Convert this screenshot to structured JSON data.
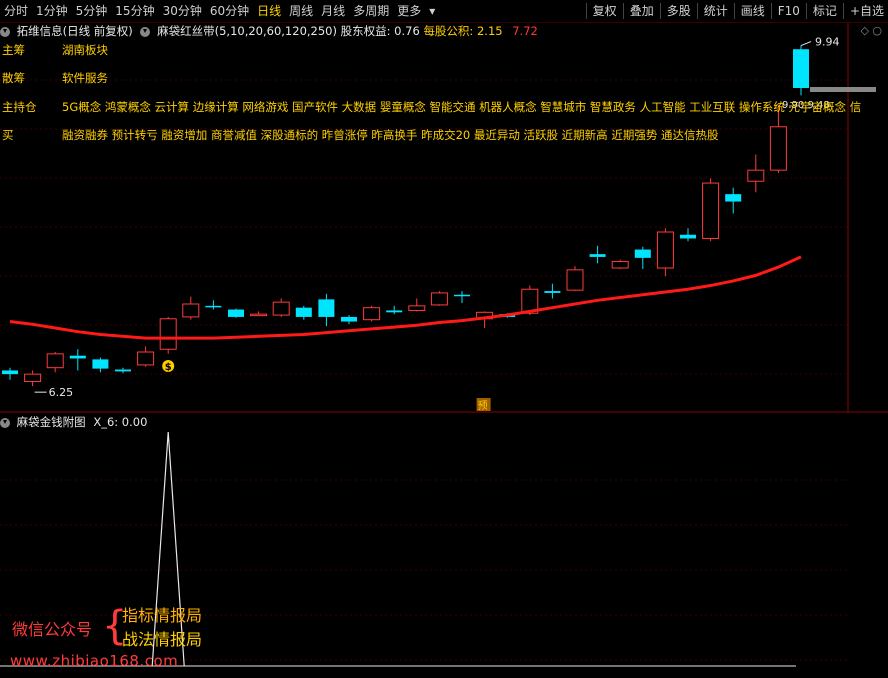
{
  "toolbar": {
    "periods": [
      "分时",
      "1分钟",
      "5分钟",
      "15分钟",
      "30分钟",
      "60分钟",
      "日线",
      "周线",
      "月线",
      "多周期",
      "更多"
    ],
    "active_period": "日线",
    "right_buttons": [
      "复权",
      "叠加",
      "多股",
      "统计",
      "画线",
      "F10",
      "标记",
      "+自选"
    ]
  },
  "info": {
    "stock": "拓维信息(日线 前复权)",
    "indicator": "麻袋红丝带(5,10,20,60,120,250)",
    "equity_label": "股东权益:",
    "equity_value": "0.76",
    "navps_label": "每股公积:",
    "navps_value": "2.15",
    "price": "7.72"
  },
  "labels": {
    "main": {
      "tag": "主筹",
      "value": "湖南板块"
    },
    "retail": {
      "tag": "散筹",
      "value": "软件服务"
    },
    "holdings": {
      "tag": "主持仓",
      "value": "5G概念 鸿蒙概念 云计算 边缘计算 网络游戏 国产软件 大数据 婴童概念 智能交通 机器人概念 智慧城市 智慧政务 人工智能 工业互联 操作系统 元宇宙概念 信"
    },
    "buy": {
      "tag": "买",
      "value": "融资融券 预计转亏 融资增加 商誉减值 深股通标的 昨曾涨停 昨高换手 昨成交20 最近异动 活跃股 近期新高 近期强势 通达信热股"
    }
  },
  "annotations": {
    "high": "9.94",
    "low": "6.25",
    "overlap": "9.90 9.48",
    "pre_marker": "预",
    "money_marker": "$"
  },
  "sub_panel": {
    "title": "麻袋金钱附图",
    "value_label": "X_6: 0.00"
  },
  "watermark": {
    "left": "微信公众号",
    "brace": "{",
    "line1": "指标情报局",
    "line2": "战法情报局",
    "url": "www.zhibiao168.com"
  },
  "colors": {
    "up": "#ff3b3b",
    "down": "#00e5ff",
    "ma": "#ff1a1a",
    "bg": "#000000",
    "highlight": "#ffd000"
  },
  "chart_data": {
    "type": "candlestick",
    "candles": [
      {
        "o": 6.42,
        "c": 6.38,
        "h": 6.45,
        "l": 6.32
      },
      {
        "o": 6.3,
        "c": 6.38,
        "h": 6.42,
        "l": 6.25
      },
      {
        "o": 6.45,
        "c": 6.6,
        "h": 6.62,
        "l": 6.4
      },
      {
        "o": 6.58,
        "c": 6.55,
        "h": 6.65,
        "l": 6.42
      },
      {
        "o": 6.54,
        "c": 6.44,
        "h": 6.56,
        "l": 6.4
      },
      {
        "o": 6.43,
        "c": 6.41,
        "h": 6.45,
        "l": 6.39
      },
      {
        "o": 6.48,
        "c": 6.62,
        "h": 6.68,
        "l": 6.46
      },
      {
        "o": 6.65,
        "c": 6.98,
        "h": 7.0,
        "l": 6.6
      },
      {
        "o": 7.0,
        "c": 7.14,
        "h": 7.22,
        "l": 6.97
      },
      {
        "o": 7.12,
        "c": 7.11,
        "h": 7.18,
        "l": 7.08
      },
      {
        "o": 7.08,
        "c": 7.0,
        "h": 7.09,
        "l": 6.99
      },
      {
        "o": 7.02,
        "c": 7.03,
        "h": 7.06,
        "l": 7.01
      },
      {
        "o": 7.02,
        "c": 7.16,
        "h": 7.2,
        "l": 7.0
      },
      {
        "o": 7.1,
        "c": 7.0,
        "h": 7.12,
        "l": 6.97
      },
      {
        "o": 7.19,
        "c": 7.0,
        "h": 7.25,
        "l": 6.9
      },
      {
        "o": 7.0,
        "c": 6.95,
        "h": 7.02,
        "l": 6.92
      },
      {
        "o": 6.97,
        "c": 7.1,
        "h": 7.12,
        "l": 6.95
      },
      {
        "o": 7.07,
        "c": 7.05,
        "h": 7.12,
        "l": 7.03
      },
      {
        "o": 7.07,
        "c": 7.12,
        "h": 7.2,
        "l": 7.06
      },
      {
        "o": 7.13,
        "c": 7.26,
        "h": 7.28,
        "l": 7.12
      },
      {
        "o": 7.24,
        "c": 7.23,
        "h": 7.28,
        "l": 7.15
      },
      {
        "o": 6.98,
        "c": 7.05,
        "h": 7.06,
        "l": 6.88
      },
      {
        "o": 7.03,
        "c": 7.0,
        "h": 7.04,
        "l": 6.99
      },
      {
        "o": 7.04,
        "c": 7.3,
        "h": 7.34,
        "l": 7.02
      },
      {
        "o": 7.28,
        "c": 7.26,
        "h": 7.36,
        "l": 7.2
      },
      {
        "o": 7.29,
        "c": 7.51,
        "h": 7.55,
        "l": 7.28
      },
      {
        "o": 7.68,
        "c": 7.65,
        "h": 7.77,
        "l": 7.58
      },
      {
        "o": 7.53,
        "c": 7.6,
        "h": 7.62,
        "l": 7.52
      },
      {
        "o": 7.73,
        "c": 7.64,
        "h": 7.76,
        "l": 7.52
      },
      {
        "o": 7.53,
        "c": 7.92,
        "h": 7.96,
        "l": 7.44
      },
      {
        "o": 7.89,
        "c": 7.85,
        "h": 7.96,
        "l": 7.82
      },
      {
        "o": 7.85,
        "c": 8.45,
        "h": 8.5,
        "l": 7.82
      },
      {
        "o": 8.33,
        "c": 8.25,
        "h": 8.4,
        "l": 8.12
      },
      {
        "o": 8.47,
        "c": 8.59,
        "h": 8.76,
        "l": 8.35
      },
      {
        "o": 8.59,
        "c": 9.06,
        "h": 9.3,
        "l": 8.56
      },
      {
        "o": 9.9,
        "c": 9.48,
        "h": 9.94,
        "l": 9.4
      }
    ],
    "ma_line": [
      6.95,
      6.92,
      6.88,
      6.84,
      6.81,
      6.79,
      6.77,
      6.77,
      6.77,
      6.77,
      6.78,
      6.79,
      6.8,
      6.81,
      6.83,
      6.85,
      6.87,
      6.89,
      6.91,
      6.94,
      6.96,
      6.99,
      7.02,
      7.06,
      7.1,
      7.14,
      7.18,
      7.21,
      7.24,
      7.27,
      7.3,
      7.34,
      7.39,
      7.45,
      7.54,
      7.65
    ],
    "ma_label": "麻袋红丝带",
    "ylim": [
      6.1,
      10.0
    ],
    "sub_panel_spike_index": 7,
    "sub_panel_spike_value": 1,
    "sub_panel_ylim": [
      0,
      1
    ]
  }
}
